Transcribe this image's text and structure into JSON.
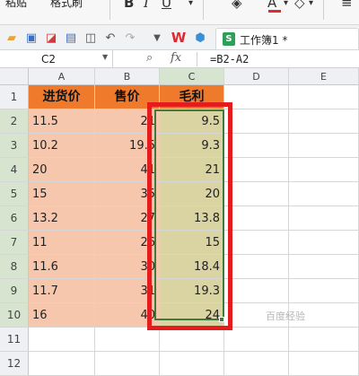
{
  "ribbon": {
    "paste_label": "粘贴",
    "format_painter_label": "格式刷",
    "bold": "B",
    "italic": "I",
    "underline": "U",
    "font_color_label": "A",
    "accent_underline": "#e12b2b"
  },
  "toolbar": {
    "icons": [
      "folder-icon",
      "save-icon",
      "export-pdf-icon",
      "print-icon",
      "print-preview-icon",
      "undo-icon",
      "redo-icon",
      "dropdown-icon",
      "wps-logo-icon",
      "cube-icon"
    ],
    "doc_title": "工作簿1 *"
  },
  "formula_bar": {
    "cell_ref": "C2",
    "fx": "fx",
    "formula": "=B2-A2"
  },
  "sheet": {
    "columns": [
      "A",
      "B",
      "C",
      "D",
      "E"
    ],
    "rows": [
      "1",
      "2",
      "3",
      "4",
      "5",
      "6",
      "7",
      "8",
      "9",
      "10",
      "11",
      "12"
    ],
    "headers": [
      "进货价",
      "售价",
      "毛利"
    ],
    "data": [
      [
        "11.5",
        "21",
        "9.5"
      ],
      [
        "10.2",
        "19.5",
        "9.3"
      ],
      [
        "20",
        "41",
        "21"
      ],
      [
        "15",
        "35",
        "20"
      ],
      [
        "13.2",
        "27",
        "13.8"
      ],
      [
        "11",
        "26",
        "15"
      ],
      [
        "11.6",
        "30",
        "18.4"
      ],
      [
        "11.7",
        "31",
        "19.3"
      ],
      [
        "16",
        "40",
        "24"
      ]
    ]
  },
  "colors": {
    "header_fill": "#f07a2b",
    "data_fill": "#f7c7ad",
    "result_fill": "#dad3a2",
    "selection_border": "#3d7a3b",
    "annotation_box": "#e41c1c"
  },
  "watermark": "百度经验"
}
